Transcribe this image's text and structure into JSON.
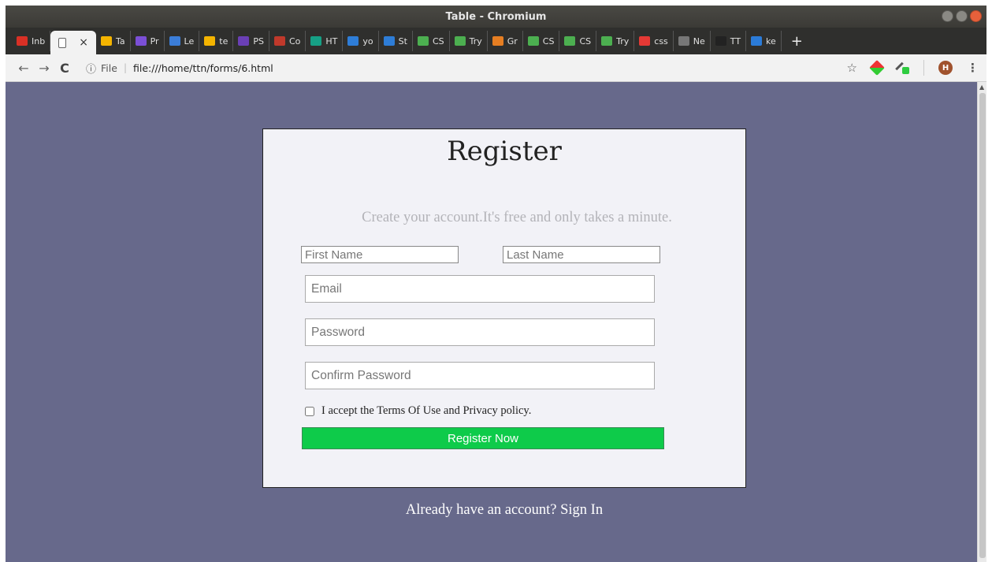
{
  "window": {
    "title": "Table - Chromium"
  },
  "tabs": [
    {
      "label": "Inb",
      "icon": "gmail-icon",
      "color": "#d93025"
    },
    {
      "label": "",
      "icon": "page-icon",
      "active": true
    },
    {
      "label": "Ta",
      "icon": "slides-icon",
      "color": "#f4b400"
    },
    {
      "label": "Pr",
      "icon": "color-wheel-icon",
      "color": "#7b4fd6"
    },
    {
      "label": "Le",
      "icon": "color-wheel-icon",
      "color": "#3b7dd8"
    },
    {
      "label": "te",
      "icon": "slides-icon",
      "color": "#f4b400"
    },
    {
      "label": "PS",
      "icon": "code-icon",
      "color": "#6a3fb5"
    },
    {
      "label": "Co",
      "icon": "image-icon",
      "color": "#c0392b"
    },
    {
      "label": "HT",
      "icon": "photo-icon",
      "color": "#16a085"
    },
    {
      "label": "yo",
      "icon": "flag-icon",
      "color": "#2e7dd7"
    },
    {
      "label": "St",
      "icon": "flag-icon",
      "color": "#2e7dd7"
    },
    {
      "label": "CS",
      "icon": "w3-icon",
      "color": "#4caf50"
    },
    {
      "label": "Try",
      "icon": "w3-icon",
      "color": "#4caf50"
    },
    {
      "label": "Gr",
      "icon": "palette-icon",
      "color": "#e67e22"
    },
    {
      "label": "CS",
      "icon": "w3-icon",
      "color": "#4caf50"
    },
    {
      "label": "CS",
      "icon": "w3-icon",
      "color": "#4caf50"
    },
    {
      "label": "Try",
      "icon": "w3-icon",
      "color": "#4caf50"
    },
    {
      "label": "css",
      "icon": "mountain-icon",
      "color": "#e53935"
    },
    {
      "label": "Ne",
      "icon": "page-icon",
      "color": "#777777"
    },
    {
      "label": "TT",
      "icon": "github-icon",
      "color": "#222222"
    },
    {
      "label": "ke",
      "icon": "vscode-icon",
      "color": "#2b7bd8"
    }
  ],
  "addressbar": {
    "scheme": "File",
    "url": "file:///home/ttn/forms/6.html",
    "avatar_initial": "H"
  },
  "form": {
    "title": "Register",
    "subtitle": "Create your account.It's free and only takes a minute.",
    "first_name_placeholder": "First Name",
    "last_name_placeholder": "Last Name",
    "email_placeholder": "Email",
    "password_placeholder": "Password",
    "confirm_password_placeholder": "Confirm Password",
    "terms_label": "I accept the Terms Of Use and Privacy policy.",
    "submit_label": "Register Now",
    "signin_text": "Already have an account? Sign In"
  },
  "colors": {
    "page_background": "#67698b",
    "card_background": "#f2f2f7",
    "button": "#0ecb4a"
  }
}
